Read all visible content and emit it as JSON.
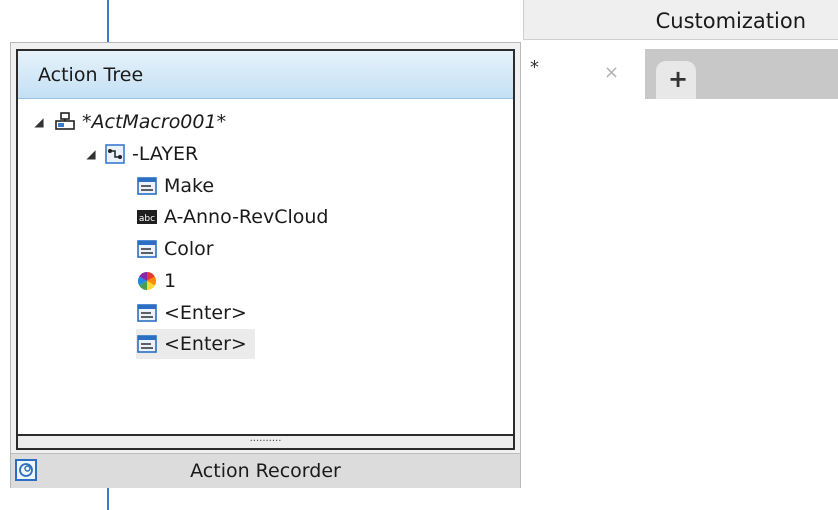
{
  "background": {
    "customization_tab": "Customization",
    "doc_tab_marker": "*",
    "doc_tab_close": "×",
    "new_tab": "+"
  },
  "palette": {
    "tree_title": "Action Tree",
    "splitter_grip": "··········",
    "recorder_label": "Action Recorder"
  },
  "tree": {
    "root": {
      "label": "*ActMacro001*",
      "icon": "macro-icon"
    },
    "command": {
      "label": "-LAYER",
      "icon": "command-icon"
    },
    "items": [
      {
        "label": "Make",
        "icon": "command-input-icon"
      },
      {
        "label": "A-Anno-RevCloud",
        "icon": "text-input-icon"
      },
      {
        "label": "Color",
        "icon": "command-input-icon"
      },
      {
        "label": "1",
        "icon": "color-wheel-icon"
      },
      {
        "label": "<Enter>",
        "icon": "command-input-icon"
      },
      {
        "label": "<Enter>",
        "icon": "command-input-icon",
        "selected": true
      }
    ]
  },
  "colors": {
    "header_top": "#e6f2fb",
    "header_bottom": "#c4e0f4",
    "accent": "#2a6fc4",
    "selected_row": "#ebebeb"
  }
}
